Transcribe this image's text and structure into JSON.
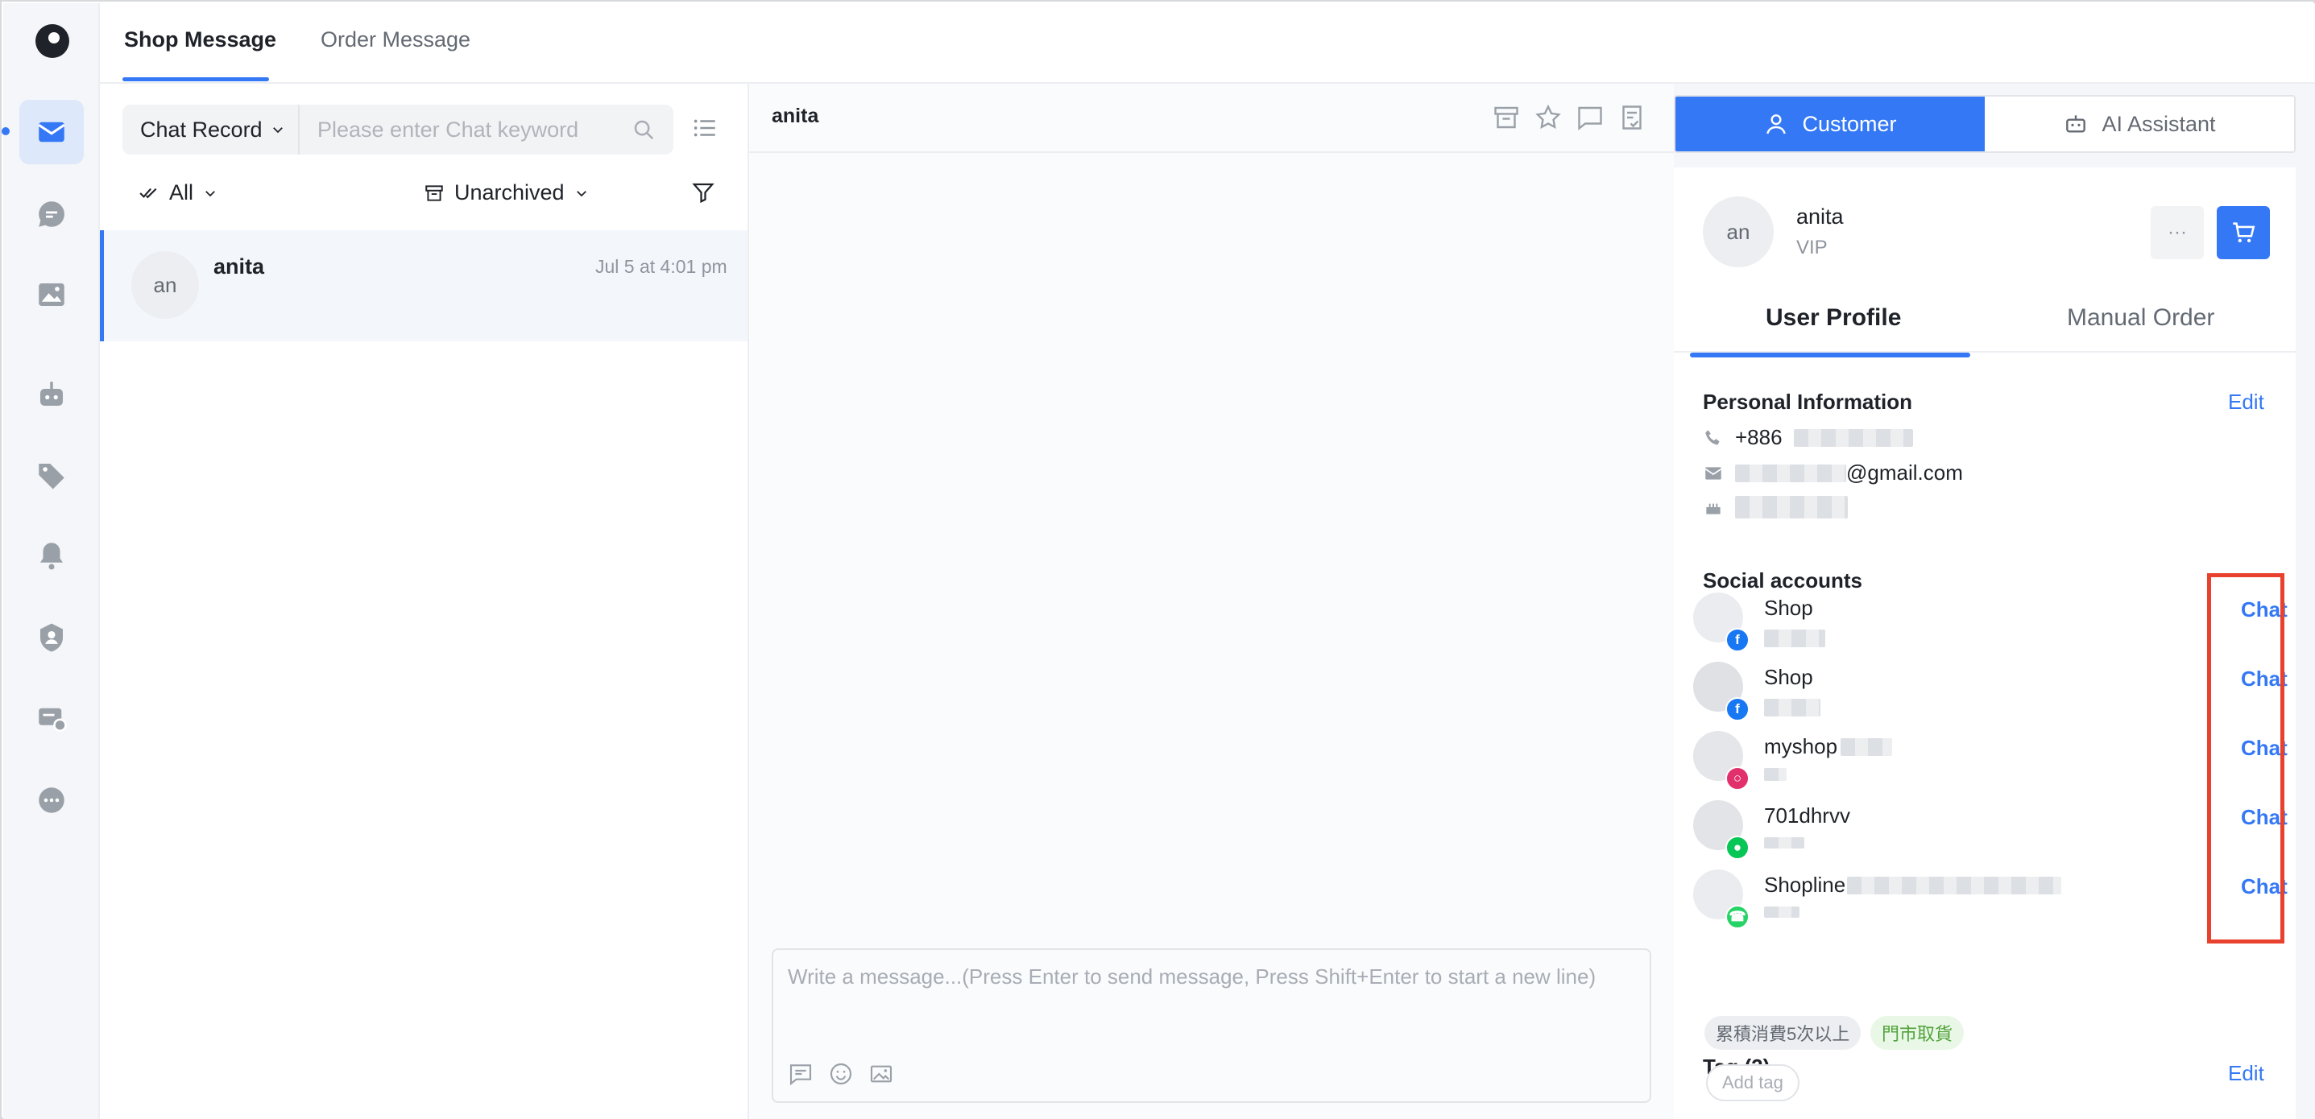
{
  "rail": {
    "items": [
      {
        "icon": "mail-icon",
        "active": true
      },
      {
        "icon": "chat-bubble-icon",
        "active": false
      },
      {
        "icon": "image-icon",
        "active": false
      },
      {
        "icon": "robot-icon",
        "active": false
      },
      {
        "icon": "tag-icon",
        "active": false
      },
      {
        "icon": "bell-icon",
        "active": false
      },
      {
        "icon": "user-shield-icon",
        "active": false
      },
      {
        "icon": "message-settings-icon",
        "active": false
      },
      {
        "icon": "more-icon",
        "active": false
      }
    ],
    "accent": "#3478f6"
  },
  "top_tabs": {
    "shop_message": "Shop Message",
    "order_message": "Order Message"
  },
  "list": {
    "search_scope": "Chat Record",
    "search_placeholder": "Please enter Chat keyword",
    "filter_all": "All",
    "filter_archive": "Unarchived",
    "conversations": [
      {
        "avatar": "an",
        "name": "anita",
        "time": "Jul 5 at 4:01 pm"
      }
    ]
  },
  "chat": {
    "title": "anita",
    "composer_placeholder": "Write a message...(Press Enter to send message, Press Shift+Enter to start a new line)"
  },
  "panel": {
    "tab_customer": "Customer",
    "tab_ai": "AI Assistant",
    "customer": {
      "avatar": "an",
      "name": "anita",
      "level": "VIP",
      "more": "···"
    },
    "sub_tabs": {
      "profile": "User Profile",
      "manual_order": "Manual Order"
    },
    "personal": {
      "title": "Personal Information",
      "edit": "Edit",
      "phone_prefix": "+886",
      "email_suffix": "@gmail.com"
    },
    "social": {
      "title": "Social accounts",
      "accounts": [
        {
          "name": "Shop",
          "platform": "facebook",
          "chat": "Chat"
        },
        {
          "name": "Shop",
          "platform": "facebook",
          "chat": "Chat"
        },
        {
          "name": "myshop",
          "platform": "instagram",
          "chat": "Chat"
        },
        {
          "name": "701dhrvv",
          "platform": "line",
          "chat": "Chat"
        },
        {
          "name": "Shopline",
          "platform": "whatsapp",
          "chat": "Chat"
        }
      ]
    },
    "tags": {
      "title": "Tag (2)",
      "edit": "Edit",
      "items": [
        "累積消費5次以上",
        "門市取貨"
      ],
      "add": "Add tag"
    }
  },
  "colors": {
    "accent": "#3478f6",
    "highlight": "#e8412e",
    "facebook": "#1877f2",
    "instagram": "#e1306c",
    "line": "#06c755",
    "whatsapp": "#25d366"
  }
}
